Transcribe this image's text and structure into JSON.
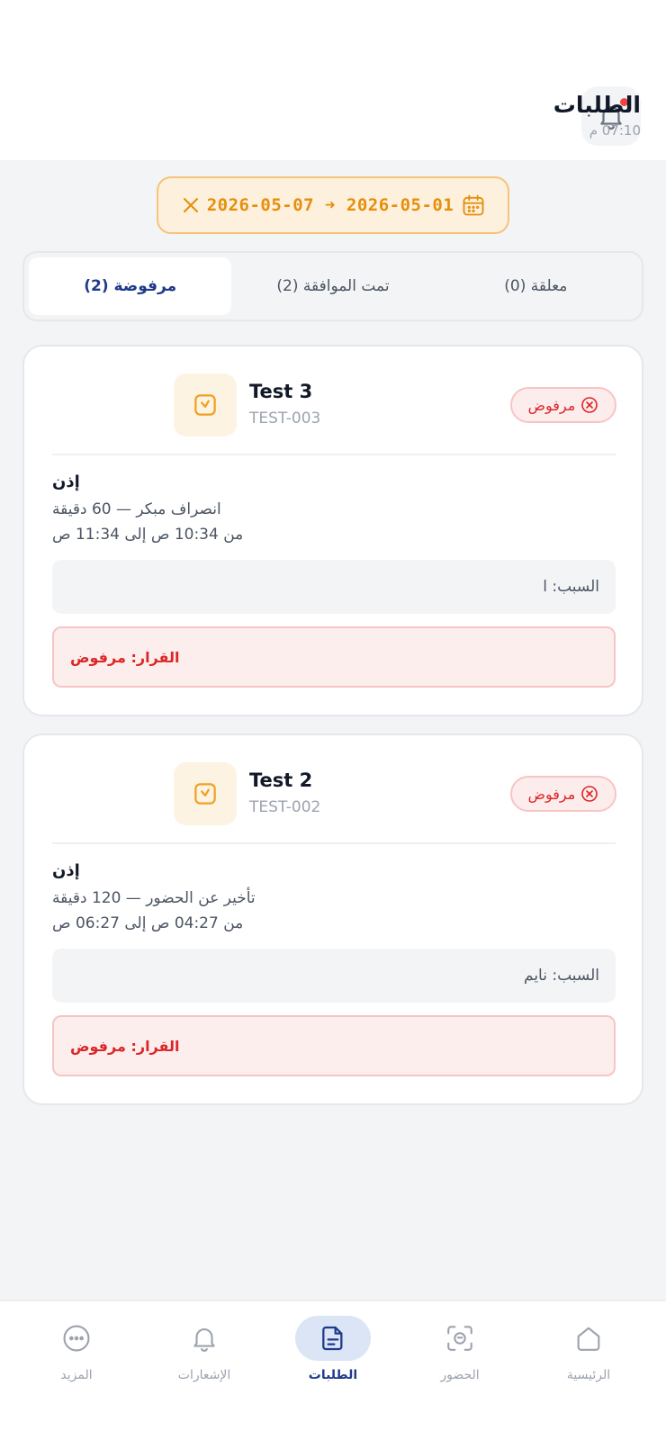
{
  "header": {
    "title": "الطلبات",
    "time": "07:10 م"
  },
  "filter": {
    "date_range": "2026-05-07 ➜ 2026-05-01"
  },
  "tabs": [
    {
      "label": "مرفوضة (2)",
      "active": true
    },
    {
      "label": "تمت الموافقة (2)",
      "active": false
    },
    {
      "label": "معلقة (0)",
      "active": false
    }
  ],
  "requests": [
    {
      "name": "Test 3",
      "code": "TEST-003",
      "status": "مرفوض",
      "type": "إذن",
      "detail": "انصراف مبكر — 60 دقيقة",
      "time_range": "من 10:34 ص إلى 11:34 ص",
      "reason": "السبب: ا",
      "decision": "القرار: مرفوض"
    },
    {
      "name": "Test 2",
      "code": "TEST-002",
      "status": "مرفوض",
      "type": "إذن",
      "detail": "تأخير عن الحضور — 120 دقيقة",
      "time_range": "من 04:27 ص إلى 06:27 ص",
      "reason": "السبب: نايم",
      "decision": "القرار: مرفوض"
    }
  ],
  "nav": [
    {
      "label": "المزيد",
      "icon": "more-icon"
    },
    {
      "label": "الإشعارات",
      "icon": "bell-icon"
    },
    {
      "label": "الطلبات",
      "icon": "document-icon",
      "active": true
    },
    {
      "label": "الحضور",
      "icon": "face-scan-icon"
    },
    {
      "label": "الرئيسية",
      "icon": "home-icon"
    }
  ],
  "colors": {
    "accent": "#1e3a8a",
    "warning": "#e58f0b",
    "danger": "#dc2626"
  }
}
